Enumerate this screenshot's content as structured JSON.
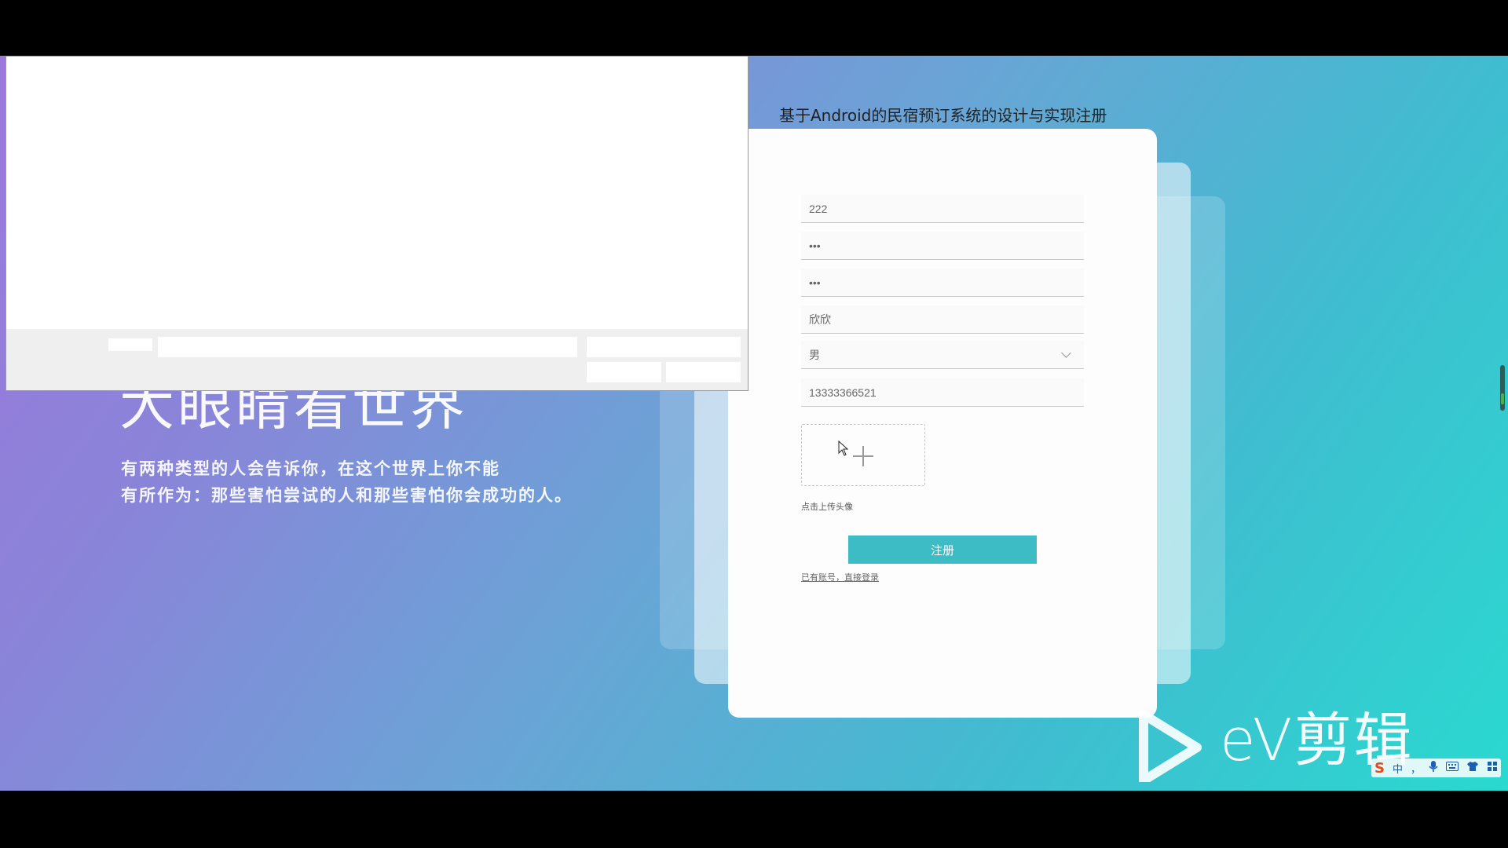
{
  "hero": {
    "title": "大眼睛看世界",
    "line1": "有两种类型的人会告诉你，在这个世界上你不能",
    "line2": "有所作为：那些害怕尝试的人和那些害怕你会成功的人。"
  },
  "form": {
    "title": "基于Android的民宿预订系统的设计与实现注册",
    "username_value": "222",
    "password_value": "•••",
    "confirm_password_value": "•••",
    "name_value": "欣欣",
    "gender_value": "男",
    "phone_value": "13333366521",
    "upload_label": "点击上传头像",
    "register_label": "注册",
    "login_link": "已有账号，直接登录"
  },
  "branding": {
    "watermark_text": "eV剪辑"
  },
  "ime": {
    "logo": "S",
    "mode": "中",
    "punct": "，",
    "icons": [
      "mic-icon",
      "keyboard-icon",
      "shirt-icon",
      "grid-icon"
    ]
  },
  "colors": {
    "register_button": "#3dbcc6",
    "gradient_start": "#9b78dc",
    "gradient_end": "#2ad9d0"
  }
}
